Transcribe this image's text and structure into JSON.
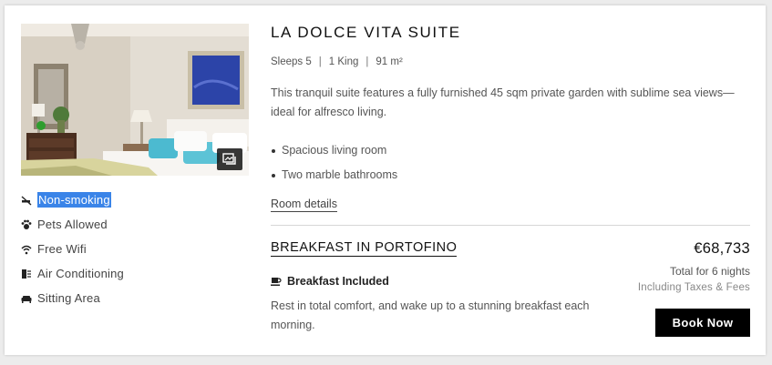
{
  "room": {
    "title": "LA DOLCE VITA SUITE",
    "specs": {
      "sleeps": "Sleeps 5",
      "bed": "1 King",
      "size": "91 m²",
      "separator": "|"
    },
    "description": "This tranquil suite features a fully furnished 45 sqm private garden with sublime sea views—ideal for alfresco living.",
    "highlights": [
      "Spacious living room",
      "Two marble bathrooms"
    ],
    "details_link": "Room details",
    "photo_gallery_icon": "image-gallery-icon"
  },
  "features": [
    {
      "label": "Non-smoking",
      "icon": "no-smoking-icon"
    },
    {
      "label": "Pets Allowed",
      "icon": "paw-icon"
    },
    {
      "label": "Free Wifi",
      "icon": "wifi-icon"
    },
    {
      "label": "Air Conditioning",
      "icon": "air-conditioning-icon"
    },
    {
      "label": "Sitting Area",
      "icon": "sofa-icon"
    }
  ],
  "rate": {
    "title": "BREAKFAST IN PORTOFINO",
    "meal_label": "Breakfast Included",
    "meal_icon": "coffee-cup-icon",
    "description": "Rest in total comfort, and wake up to a stunning breakfast each morning.",
    "price": "€68,733",
    "nights": "Total for 6 nights",
    "taxes": "Including Taxes & Fees",
    "book_label": "Book Now"
  },
  "colors": {
    "selection_highlight": "#3a84e8",
    "button": "#000000",
    "divider": "#d6d6d6"
  }
}
